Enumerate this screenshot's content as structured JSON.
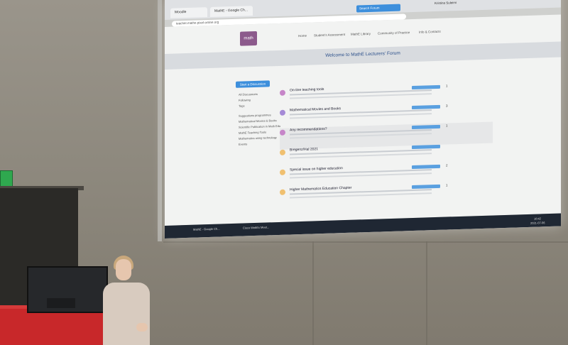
{
  "browser": {
    "tabs": [
      "Moodle",
      "MathE - Google Ch..."
    ],
    "address": "teacher.mathe.pixel-online.org",
    "search_label": "Search Forum",
    "user_name": "Kristina Suleimi"
  },
  "site": {
    "logo_text": "math",
    "nav": [
      "Home",
      "Student's Assessment",
      "MathE Library",
      "Community of Practice",
      "Info & Contacts"
    ],
    "banner_title": "Welcome to MathE Lecturers' Forum"
  },
  "sidebar": {
    "start_button": "Start a Discussion",
    "items": [
      "All Discussions",
      "Following",
      "Tags",
      "Suggestions programmes",
      "Mathematical Movies & Books",
      "Scientific Publication in Math Edu",
      "MathE Teaching Tools",
      "Mathematics using technology",
      "Events"
    ]
  },
  "posts": [
    {
      "title": "On-line teaching tools",
      "tag": "MathE Teaching Tools",
      "count": "1",
      "color": "#c685c8"
    },
    {
      "title": "Mathematical Movies and Books",
      "tag": "Mathematical Movies & Books",
      "count": "3",
      "color": "#a58ad6"
    },
    {
      "title": "Any recommendations?",
      "tag": "MathE Teaching Tools",
      "count": "1",
      "color": "#c685c8"
    },
    {
      "title": "Bregenz/Hal 2021",
      "tag": "Scientific Publication in Math Edu",
      "count": "",
      "color": "#f0c070"
    },
    {
      "title": "Special issue on higher education",
      "tag": "Scientific Publication in Math Edu",
      "count": "2",
      "color": "#f0c070"
    },
    {
      "title": "Higher Mathematics Education Chapter",
      "tag": "Scientific Publication in Math Edu",
      "count": "1",
      "color": "#f0c070"
    }
  ],
  "taskbar": {
    "items": [
      "MathE - Google Ch...",
      "Cisco WebEx Meet..."
    ],
    "clock": "10:42",
    "date": "2021-07-06"
  }
}
